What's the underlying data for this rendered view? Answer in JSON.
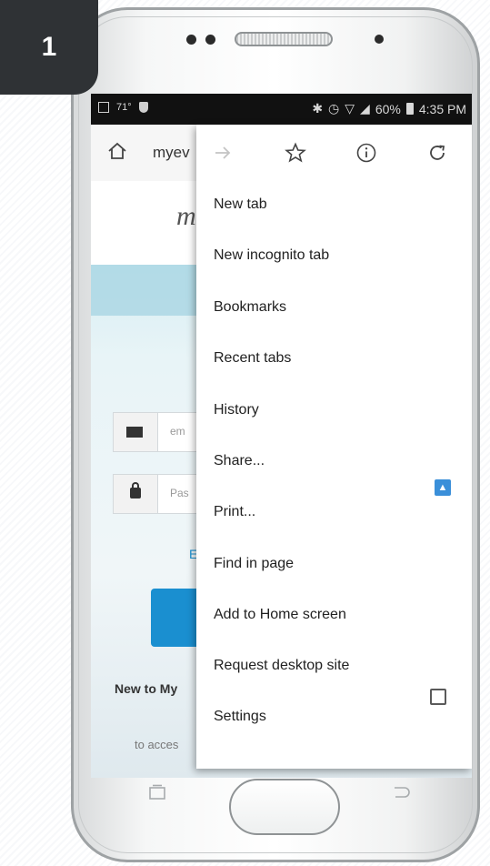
{
  "step": {
    "number": "1"
  },
  "status_bar": {
    "temp": "71°",
    "battery": "60%",
    "time": "4:35 PM"
  },
  "browser": {
    "url_text": "myev"
  },
  "page": {
    "logo_text": "m",
    "email_placeholder": "em",
    "password_placeholder": "Pas",
    "link_text": "E",
    "new_to_text": "New to My",
    "access_text": "to acces"
  },
  "menu": {
    "icons": [
      "forward-icon",
      "star-icon",
      "info-icon",
      "refresh-icon"
    ],
    "items": [
      {
        "label": "New tab"
      },
      {
        "label": "New incognito tab"
      },
      {
        "label": "Bookmarks"
      },
      {
        "label": "Recent tabs"
      },
      {
        "label": "History"
      },
      {
        "label": "Share..."
      },
      {
        "label": "Print..."
      },
      {
        "label": "Find in page"
      },
      {
        "label": "Add to Home screen"
      },
      {
        "label": "Request desktop site"
      },
      {
        "label": "Settings"
      }
    ],
    "request_desktop_checked": false
  },
  "colors": {
    "badge": "#2f3235",
    "share_app": "#3a8fd9",
    "button_blue": "#1a8fd0"
  }
}
